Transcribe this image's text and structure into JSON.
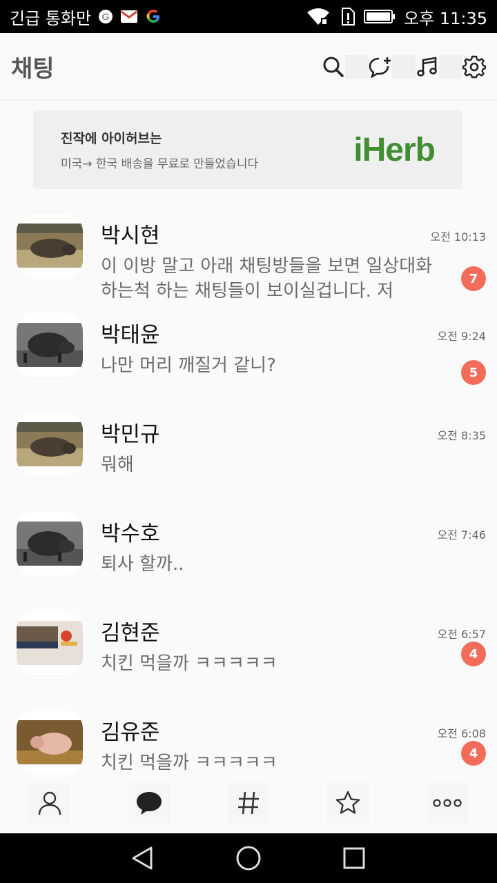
{
  "statusbar": {
    "left_text": "긴급 통화만",
    "time": "오후 11:35"
  },
  "header": {
    "title": "채팅"
  },
  "ad": {
    "line1": "진작에 아이허브는",
    "line2": "미국→ 한국 배송을 무료로 만들었습니다",
    "brand": "iHerb"
  },
  "chats": [
    {
      "name": "박시현",
      "time": "오전 10:13",
      "message": "이 이방 말고 아래 채팅방들을 보면 일상대화 하는척 하는 채팅들이 보이실겁니다. 저",
      "unread": "7"
    },
    {
      "name": "박태윤",
      "time": "오전 9:24",
      "message": "나만 머리 깨질거 같니?",
      "unread": "5"
    },
    {
      "name": "박민규",
      "time": "오전 8:35",
      "message": "뭐해",
      "unread": ""
    },
    {
      "name": "박수호",
      "time": "오전 7:46",
      "message": "퇴사 할까..",
      "unread": ""
    },
    {
      "name": "김현준",
      "time": "오전 6:57",
      "message": "치킨 먹을까 ㅋㅋㅋㅋㅋ",
      "unread": "4"
    },
    {
      "name": "김유준",
      "time": "오전 6:08",
      "message": "치킨 먹을까 ㅋㅋㅋㅋㅋ",
      "unread": "4"
    }
  ],
  "colors": {
    "badge": "#f36c5a",
    "brand": "#3f8e2f"
  }
}
